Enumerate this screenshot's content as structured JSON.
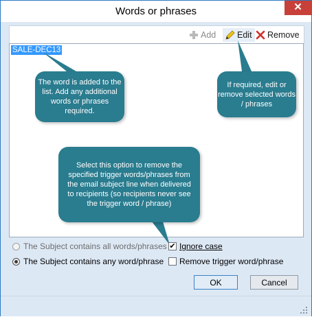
{
  "window": {
    "title": "Words or phrases",
    "close_glyph": "✕"
  },
  "toolbar": {
    "add_label": "Add",
    "edit_label": "Edit",
    "remove_label": "Remove"
  },
  "list": {
    "items": [
      "SALE-DEC13"
    ]
  },
  "callouts": {
    "added": "The word is added to the list. Add any additional words or phrases required.",
    "edit": "If required, edit or remove selected words / phrases",
    "remove_trigger": "Select this option to remove the specified trigger words/phrases from the email subject line when delivered to recipients (so recipients never see the trigger word / phrase)"
  },
  "options": {
    "all_words": {
      "label": "The Subject contains all words/phrases",
      "selected": false
    },
    "any_word": {
      "label": "The Subject contains any word/phrase",
      "selected": true
    },
    "ignore_case": {
      "label": "Ignore case",
      "checked": true
    },
    "remove_trigger": {
      "label": "Remove trigger word/phrase",
      "checked": false
    }
  },
  "buttons": {
    "ok": "OK",
    "cancel": "Cancel"
  },
  "colors": {
    "callout": "#2a7c8f",
    "selection": "#3399ff",
    "close": "#c7403a"
  }
}
